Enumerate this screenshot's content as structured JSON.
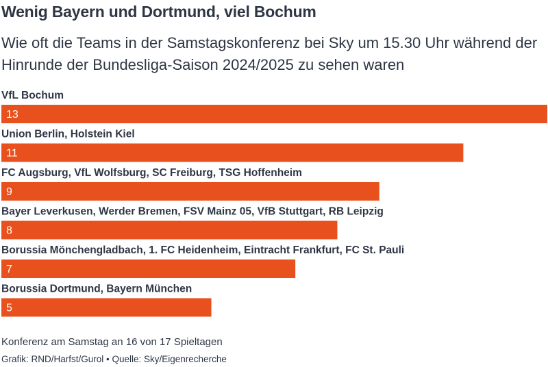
{
  "header": {
    "title": "Wenig Bayern und Dortmund, viel Bochum",
    "subtitle": "Wie oft die Teams in der Samstagskonferenz bei Sky um 15.30 Uhr während der Hinrunde der Bundesliga-Saison 2024/2025 zu sehen waren"
  },
  "chart_data": {
    "type": "bar",
    "orientation": "horizontal",
    "categories": [
      "VfL Bochum",
      "Union Berlin, Holstein Kiel",
      "FC Augsburg, VfL Wolfsburg, SC Freiburg, TSG Hoffenheim",
      "Bayer Leverkusen, Werder Bremen, FSV Mainz 05, VfB Stuttgart, RB Leipzig",
      "Borussia Mönchengladbach, 1. FC Heidenheim, Eintracht Frankfurt, FC St. Pauli",
      "Borussia Dortmund, Bayern München"
    ],
    "values": [
      13,
      11,
      9,
      8,
      7,
      5
    ],
    "xlim": [
      0,
      13
    ],
    "grid": false,
    "bar_color": "#e8511d",
    "value_label_color": "#ffffff",
    "category_label_color": "#2e3644"
  },
  "footer": {
    "note": "Konferenz am Samstag an 16 von 17 Spieltagen",
    "source": "Grafik: RND/Harfst/Gurol • Quelle: Sky/Eigenrecherche"
  }
}
